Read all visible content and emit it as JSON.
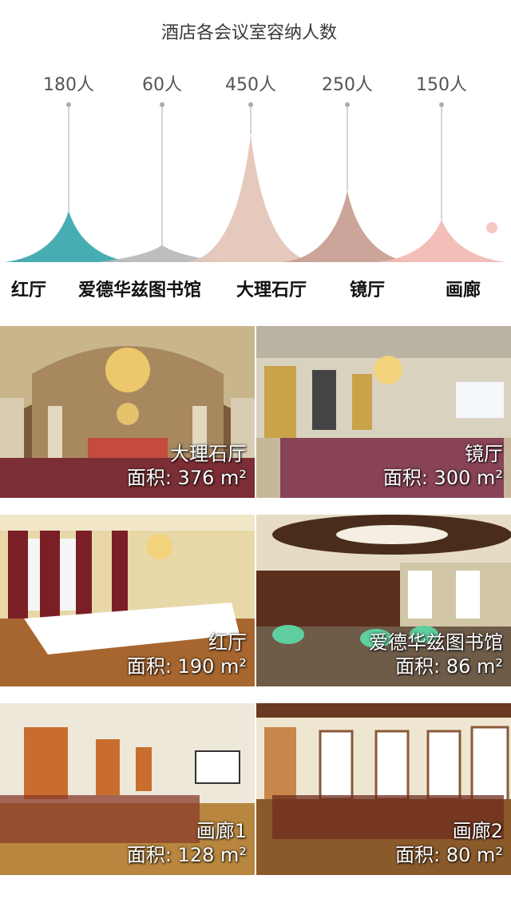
{
  "chart_data": {
    "type": "area",
    "title": "酒店各会议室容纳人数",
    "categories": [
      "红厅",
      "爱德华兹图书馆",
      "大理石厅",
      "镜厅",
      "画廊"
    ],
    "values": [
      180,
      60,
      450,
      250,
      150
    ],
    "value_labels": [
      "180人",
      "60人",
      "450人",
      "250人",
      "150人"
    ],
    "colors": [
      "#3aa7ad",
      "#b9b9b9",
      "#e4c5b8",
      "#c79e92",
      "#f2b9b3"
    ]
  },
  "photos": [
    {
      "name": "大理石厅",
      "area": "面积: 376 m²"
    },
    {
      "name": "镜厅",
      "area": "面积: 300 m²"
    },
    {
      "name": "红厅",
      "area": "面积: 190 m²"
    },
    {
      "name": "爱德华兹图书馆",
      "area": "面积: 86 m²"
    },
    {
      "name": "画廊1",
      "area": "面积: 128 m²"
    },
    {
      "name": "画廊2",
      "area": "面积: 80 m²"
    }
  ]
}
